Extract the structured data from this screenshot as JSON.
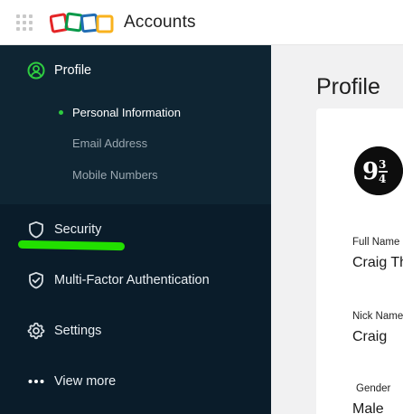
{
  "app": {
    "title": "Accounts"
  },
  "sidebar": {
    "items": [
      {
        "label": "Profile",
        "icon": "user-circle-icon",
        "active": true
      },
      {
        "label": "Security",
        "icon": "shield-icon"
      },
      {
        "label": "Multi-Factor Authentication",
        "icon": "shield-check-icon"
      },
      {
        "label": "Settings",
        "icon": "gear-icon"
      },
      {
        "label": "View more",
        "icon": "more-dots-icon"
      }
    ],
    "profile_subitems": [
      {
        "label": "Personal Information",
        "active": true
      },
      {
        "label": "Email Address"
      },
      {
        "label": "Mobile Numbers"
      }
    ]
  },
  "main": {
    "page_title": "Profile",
    "fields": [
      {
        "label": "Full Name",
        "value": "Craig Th"
      },
      {
        "label": "Nick Name",
        "value": "Craig"
      },
      {
        "label": "Gender",
        "value": "Male"
      }
    ]
  },
  "colors": {
    "sidebar_bg": "#0a1c2a",
    "profile_group_bg": "#0f2533",
    "accent_green": "#2ecc40",
    "highlight_green": "#22e000",
    "main_bg": "#f1f1f2"
  }
}
